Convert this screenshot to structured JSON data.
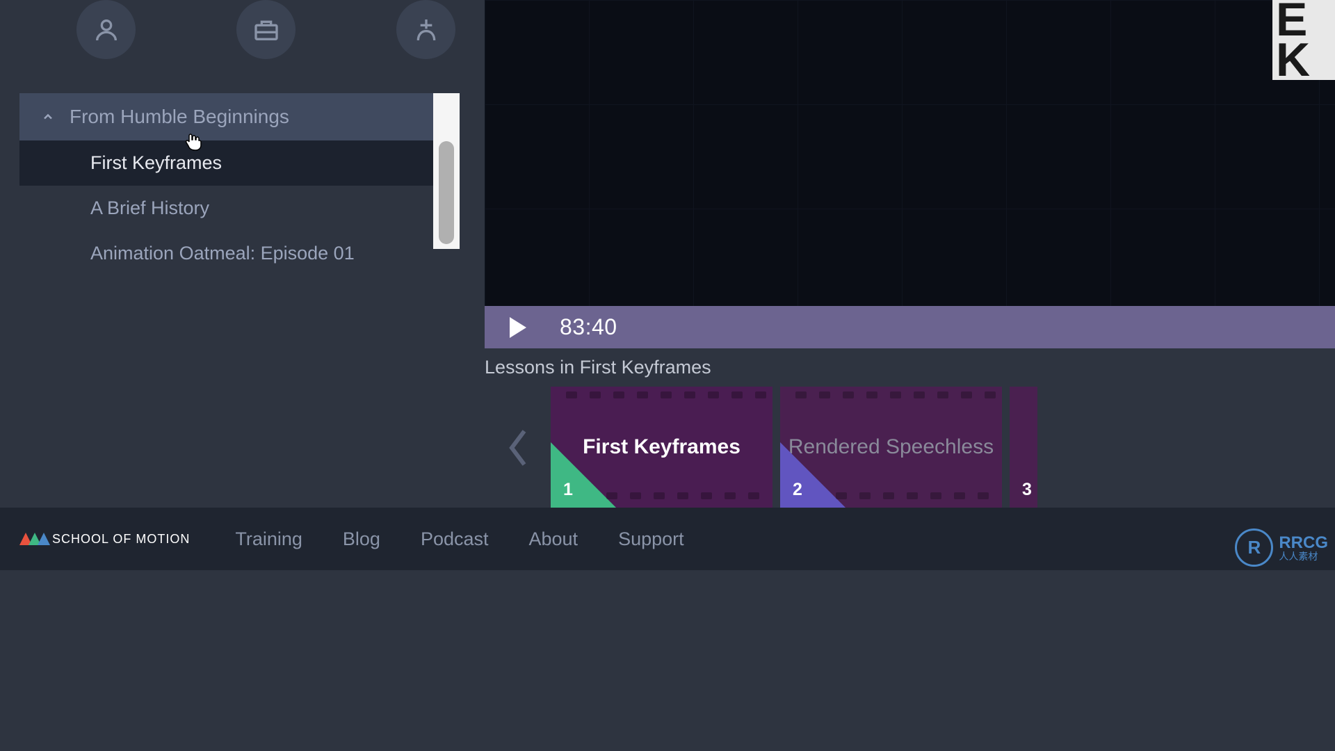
{
  "sidebar": {
    "section_title": "From Humble Beginnings",
    "items": [
      {
        "label": "First Keyframes",
        "active": true
      },
      {
        "label": "A Brief History",
        "active": false
      },
      {
        "label": "Animation Oatmeal: Episode 01",
        "active": false
      }
    ]
  },
  "player": {
    "time": "83:40"
  },
  "lessons": {
    "title": "Lessons in First Keyframes",
    "cards": [
      {
        "number": "1",
        "title": "First Keyframes",
        "active": true
      },
      {
        "number": "2",
        "title": "Rendered Speechless",
        "active": false
      },
      {
        "number": "3",
        "title": "",
        "active": false
      }
    ]
  },
  "footer": {
    "brand": "SCHOOL OF MOTION",
    "links": [
      "Training",
      "Blog",
      "Podcast",
      "About",
      "Support"
    ]
  },
  "watermark": {
    "main": "RRCG",
    "sub": "人人素材"
  },
  "corner_text": "E\nK"
}
